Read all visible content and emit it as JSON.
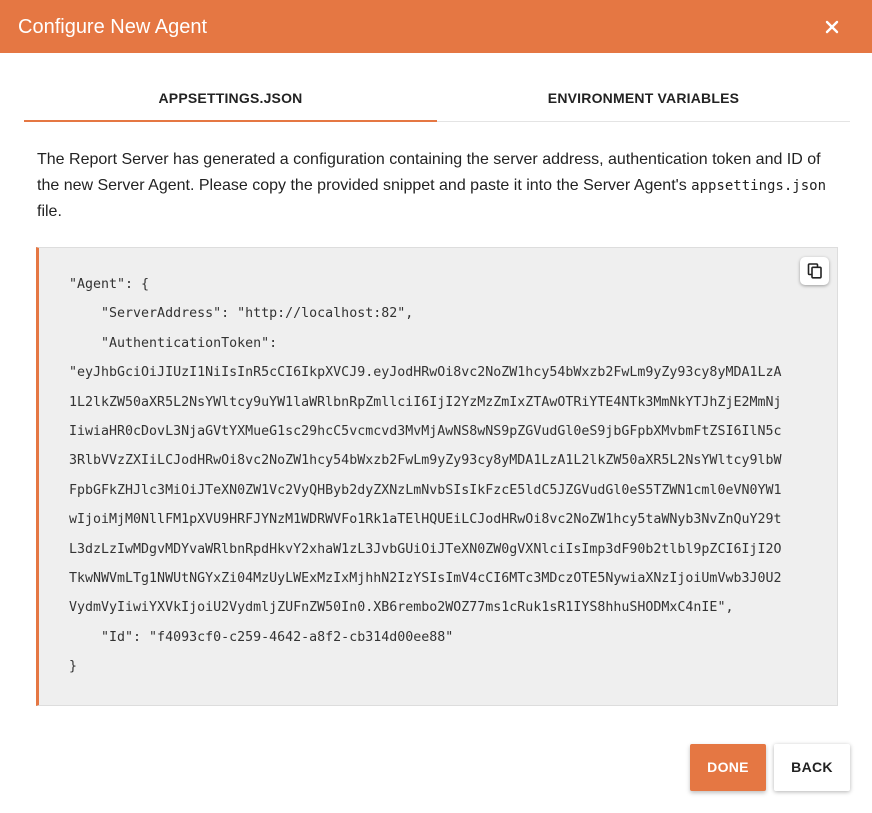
{
  "dialog": {
    "title": "Configure New Agent",
    "close_icon": "close-icon"
  },
  "tabs": [
    {
      "label": "APPSETTINGS.JSON",
      "active": true
    },
    {
      "label": "ENVIRONMENT VARIABLES",
      "active": false
    }
  ],
  "description": {
    "text_before": "The Report Server has generated a configuration containing the server address, authentication token and ID of the new Server Agent. Please copy the provided snippet and paste it into the Server Agent's ",
    "filename": "appsettings.json",
    "text_after": " file."
  },
  "code": {
    "copy_icon": "copy-icon",
    "lines": [
      "\"Agent\": {",
      "    \"ServerAddress\": \"http://localhost:82\",",
      "    \"AuthenticationToken\":",
      "\"eyJhbGciOiJIUzI1NiIsInR5cCI6IkpXVCJ9.eyJodHRwOi8vc2NoZW1hcy54bWxzb2FwLm9yZy93cy8yMDA1LzA",
      "1L2lkZW50aXR5L2NsYWltcy9uYW1laWRlbnRpZmllciI6IjI2YzMzZmIxZTAwOTRiYTE4NTk3MmNkYTJhZjE2MmNj",
      "IiwiaHR0cDovL3NjaGVtYXMueG1sc29hcC5vcmcvd3MvMjAwNS8wNS9pZGVudGl0eS9jbGFpbXMvbmFtZSI6IlN5c",
      "3RlbVVzZXIiLCJodHRwOi8vc2NoZW1hcy54bWxzb2FwLm9yZy93cy8yMDA1LzA1L2lkZW50aXR5L2NsYWltcy9lbW",
      "FpbGFkZHJlc3MiOiJTeXN0ZW1Vc2VyQHByb2dyZXNzLmNvbSIsIkFzcE5ldC5JZGVudGl0eS5TZWN1cml0eVN0YW1",
      "wIjoiMjM0NllFM1pXVU9HRFJYNzM1WDRWVFo1Rk1aTElHQUEiLCJodHRwOi8vc2NoZW1hcy5taWNyb3NvZnQuY29t",
      "L3dzLzIwMDgvMDYvaWRlbnRpdHkvY2xhaW1zL3JvbGUiOiJTeXN0ZW0gVXNlciIsImp3dF90b2tlbl9pZCI6IjI2O",
      "TkwNWVmLTg1NWUtNGYxZi04MzUyLWExMzIxMjhhN2IzYSIsImV4cCI6MTc3MDczOTE5NywiaXNzIjoiUmVwb3J0U2",
      "VydmVyIiwiYXVkIjoiU2VydmljZUFnZW50In0.XB6rembo2WOZ77ms1cRuk1sR1IYS8hhuSHODMxC4nIE\",",
      "    \"Id\": \"f4093cf0-c259-4642-a8f2-cb314d00ee88\"",
      "}"
    ]
  },
  "buttons": {
    "done": "DONE",
    "back": "BACK"
  },
  "colors": {
    "accent": "#e57743",
    "code_background": "#efefef"
  }
}
